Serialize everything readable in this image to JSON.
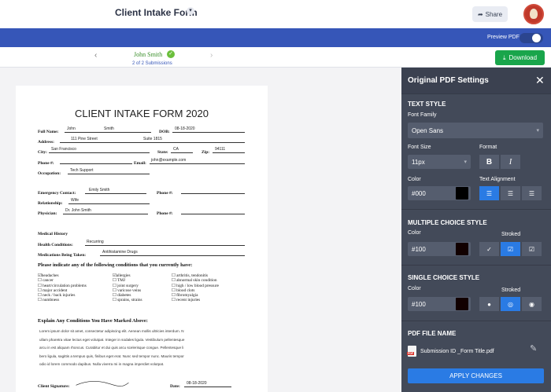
{
  "header": {
    "form_title": "Client Intake Form",
    "title_caret_icon": "chevron-down-icon",
    "share_label": "Share",
    "share_icon": "share-arrow-icon"
  },
  "toolbar": {
    "preview_label": "Preview PDF",
    "preview_on": false
  },
  "submission_nav": {
    "prev_icon": "chevron-left-icon",
    "next_icon": "chevron-right-icon",
    "name": "John Smith",
    "count": "2 of 2 Submissions",
    "download_label": "Download"
  },
  "document": {
    "title": "CLIENT INTAKE FORM 2020",
    "full_name_label": "Full Name:",
    "first_name": "John",
    "last_name": "Smith",
    "dob_label": "DOB:",
    "dob": "08-18-2020",
    "address_label": "Address:",
    "street": "111 Pine Street",
    "suite": "Suite 1815",
    "city_label": "City:",
    "city": "San Francisco",
    "state_label": "State:",
    "state": "CA",
    "zip_label": "Zip:",
    "zip": "94111",
    "phone_label": "Phone #:",
    "email_label": "Email:",
    "email": "john@example.com",
    "occupation_label": "Occupation:",
    "occupation": "Tech Support",
    "emergency_label": "Emergency Contact:",
    "emergency": "Emily Smith",
    "phone2_label": "Phone #:",
    "relationship_label": "Relationship:",
    "relationship": "Wife",
    "physician_label": "Physician:",
    "physician": "Dr. John Smith",
    "phone3_label": "Phone #:",
    "medical_history_label": "Medical History",
    "health_conditions_label": "Health Conditions:",
    "health_conditions": "Recurring",
    "medications_label": "Medications Being Taken:",
    "medications": "Antihistamine Drugs",
    "conditions_question": "Please indicate any of the following conditions that you currently have:",
    "conditions_col1": [
      "☑headaches",
      "☐ cancer",
      "☐ heart/circulation problems",
      "☐ major accident",
      "☐ neck / back injuries",
      "☐ numbness"
    ],
    "conditions_col2": [
      "☑allergies",
      "☐ TMJ",
      "☐ joint surgery",
      "☐ varicose veins",
      "☐ diabetes",
      "☐ sprains, strains"
    ],
    "conditions_col3": [
      "☐ arthritis, tendonitis",
      "☐ abnormal skin condition",
      "☐ high / low blood pressure",
      "☐ blood clots",
      "☐ fibromyalgia",
      "☐ recent injuries"
    ],
    "explain_label": "Explain Any Conditions You Have Marked Above:",
    "explain_lines": [
      "Lorem ipsum dolor sit amet, consectetur adipiscing elit. Aenean mollis ultricies interdum. N",
      "ullam pharetra vitae lectus eget volutpat. Integer in sodales ligula. Vestibulum pellentesque",
      "arcu in est aliquam rhoncus. Curabitur et dui quis arcu scelerisque congue. Pellentesque li",
      "bero ligula, sagittis a tempus quis, finibus eget erat. Nunc sed tempor nunc. Mauris tempor",
      "odio id lorem commodo dapibus. Nulla viverra mi in magna imperdiet volutpat."
    ],
    "signature_label": "Client Signature:",
    "date_label": "Date:",
    "date": "08-18-2020"
  },
  "settings": {
    "title": "Original PDF Settings",
    "close_icon": "close-icon",
    "text_style_head": "TEXT STYLE",
    "font_family_label": "Font Family",
    "font_family_value": "Open Sans",
    "font_size_label": "Font Size",
    "font_size_value": "11px",
    "format_label": "Format",
    "bold_label": "B",
    "italic_label": "I",
    "color_label": "Color",
    "text_color_value": "#000",
    "text_alignment_label": "Text Alignment",
    "multiple_choice_head": "MULTIPLE CHOICE STYLE",
    "mc_color_label": "Color",
    "mc_stroked_label": "Stroked",
    "mc_color_value": "#100",
    "single_choice_head": "SINGLE CHOICE STYLE",
    "sc_color_label": "Color",
    "sc_stroked_label": "Stroked",
    "sc_color_value": "#100",
    "pdf_file_name_head": "PDF FILE NAME",
    "pdf_file_name": "Submission ID _Form Title.pdf",
    "apply_label": "APPLY CHANGES"
  },
  "colors": {
    "brand_blue": "#3656b8",
    "download_green": "#19a54b",
    "panel_bg": "#434a59",
    "active_blue": "#2a7be4"
  }
}
